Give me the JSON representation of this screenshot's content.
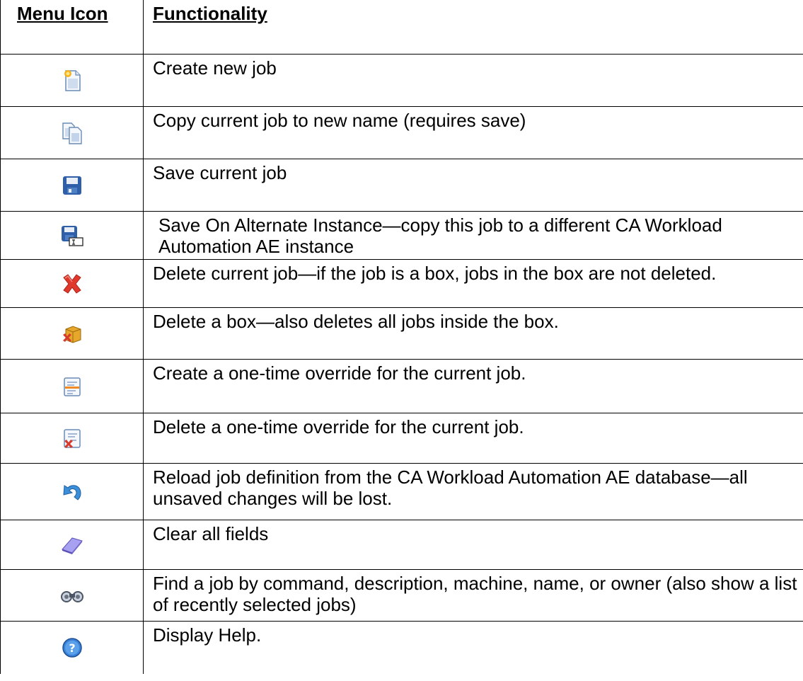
{
  "table": {
    "header": {
      "icon_col": "Menu Icon",
      "func_col": "Functionality"
    },
    "rows": [
      {
        "icon": "create-new-job-icon",
        "text": "Create new job"
      },
      {
        "icon": "copy-job-icon",
        "text": "Copy current job to new name (requires save)"
      },
      {
        "icon": "save-job-icon",
        "text": "Save current job"
      },
      {
        "icon": "save-alternate-instance-icon",
        "text": "Save On Alternate Instance—copy this job to a different CA Workload Automation AE instance"
      },
      {
        "icon": "delete-job-icon",
        "text": "Delete current job—if the job is a box, jobs in the box are not deleted."
      },
      {
        "icon": "delete-box-icon",
        "text": "Delete a box—also deletes all jobs inside the box."
      },
      {
        "icon": "create-override-icon",
        "text": "Create a one-time override for the current job."
      },
      {
        "icon": "delete-override-icon",
        "text": "Delete a one-time override for the current job."
      },
      {
        "icon": "reload-icon",
        "text": "Reload job definition from the CA Workload Automation AE database—all unsaved changes will be lost."
      },
      {
        "icon": "eraser-icon",
        "text": "Clear all fields"
      },
      {
        "icon": "binoculars-icon",
        "text": "Find a job by command, description, machine, name, or owner (also show a list of recently selected jobs)"
      },
      {
        "icon": "help-icon",
        "text": "Display Help."
      }
    ]
  }
}
